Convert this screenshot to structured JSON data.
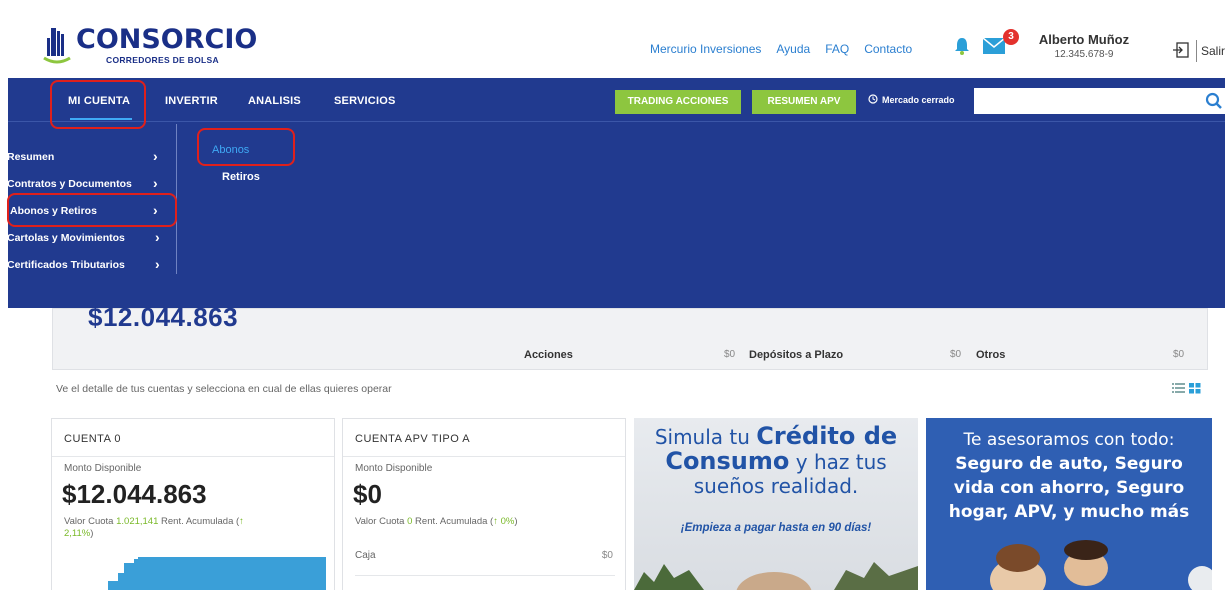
{
  "brand": {
    "name": "CONSORCIO",
    "sub": "CORREDORES DE BOLSA"
  },
  "toplinks": [
    "Mercurio Inversiones",
    "Ayuda",
    "FAQ",
    "Contacto"
  ],
  "notifications": {
    "count": "3"
  },
  "user": {
    "name": "Alberto Muñoz",
    "rut": "12.345.678-9"
  },
  "logout_label": "Salir",
  "nav": {
    "items": [
      "MI CUENTA",
      "INVERTIR",
      "ANALISIS",
      "SERVICIOS"
    ]
  },
  "buttons": {
    "trading": "TRADING ACCIONES",
    "apv": "RESUMEN APV"
  },
  "market_status": "Mercado cerrado",
  "search": {
    "placeholder": ""
  },
  "dropdown": {
    "items": [
      "Resumen",
      "Contratos y Documentos",
      "Abonos y Retiros",
      "Cartolas y Movimientos",
      "Certificados Tributarios"
    ],
    "sub_items": [
      "Abonos",
      "Retiros"
    ]
  },
  "balance": {
    "amount": "$12.044.863",
    "cols": [
      {
        "label": "Acciones",
        "value": "$0"
      },
      {
        "label": "Depósitos a Plazo",
        "value": "$0"
      },
      {
        "label": "Otros",
        "value": "$0"
      }
    ]
  },
  "detail_text": "Ve el detalle de tus cuentas y selecciona en cual de ellas quieres operar",
  "cards": [
    {
      "title": "CUENTA 0",
      "label": "Monto Disponible",
      "amount": "$12.044.863",
      "cuota_prefix": "Valor Cuota ",
      "cuota": "1.021,141",
      "rent_prefix": " Rent. Acumulada (",
      "rent_arrow": "↑",
      "rent": " 2,11%",
      "rent_suffix": ")"
    },
    {
      "title": "CUENTA APV TIPO A",
      "label": "Monto Disponible",
      "amount": "$0",
      "cuota_prefix": "Valor Cuota ",
      "cuota": "0",
      "rent_prefix": " Rent. Acumulada (",
      "rent_arrow": "↑",
      "rent": " 0%",
      "rent_suffix": ")",
      "caja_label": "Caja",
      "caja_value": "$0"
    }
  ],
  "banners": {
    "b1": {
      "line1": "Simula tu ",
      "line1_bold": "Crédito de",
      "line2_bold": "Consumo",
      "line2": " y haz tus",
      "line3": "sueños realidad.",
      "sub": "¡Empieza a pagar hasta en 90 días!"
    },
    "b2": {
      "l1": "Te asesoramos con todo:",
      "l2": "Seguro de auto, Seguro",
      "l3": "vida con ahorro, Seguro",
      "l4": "hogar, APV, y mucho más"
    }
  },
  "colors": {
    "brand_blue": "#213a8f",
    "accent_green": "#8dc63f",
    "link_blue": "#2b7fd0",
    "highlight_red": "#e0201b"
  }
}
